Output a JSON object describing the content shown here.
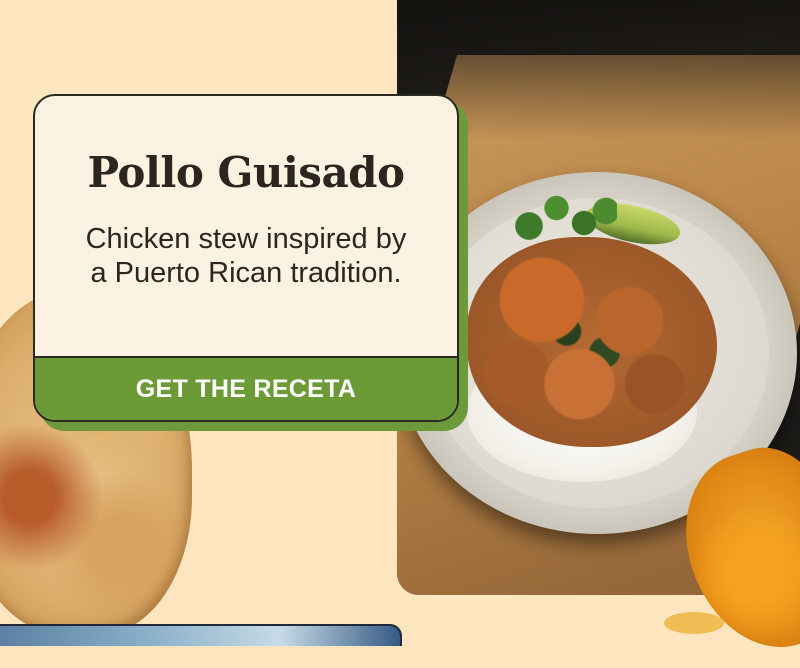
{
  "recipe_card": {
    "title": "Pollo Guisado",
    "description": "Chicken stew inspired by a Puerto Rican tradition.",
    "cta_label": "GET THE RECETA"
  },
  "colors": {
    "page_background": "#fde6bf",
    "card_background": "#fbf2e2",
    "cta_green": "#6b9a37",
    "text_dark": "#2b2620"
  }
}
